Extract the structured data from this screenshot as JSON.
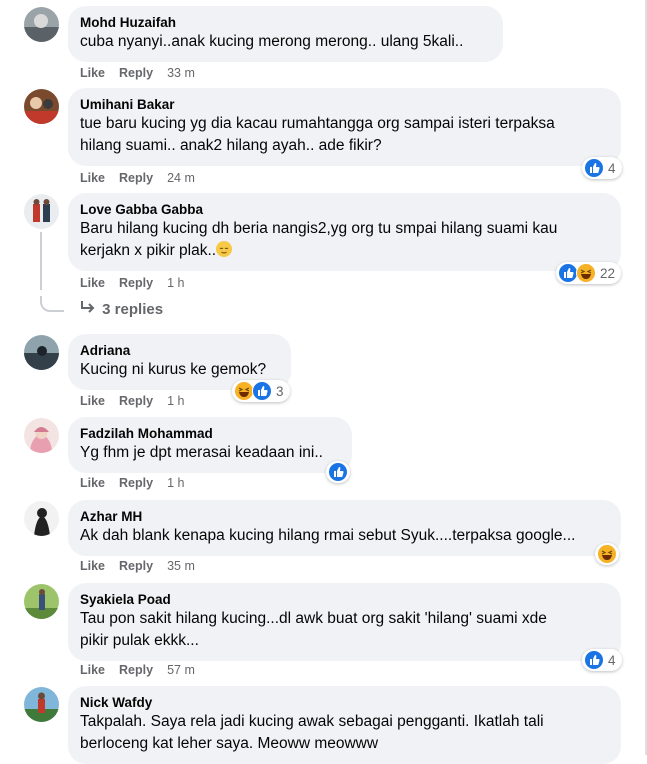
{
  "actions": {
    "like": "Like",
    "reply": "Reply"
  },
  "colors": {
    "bubble": "#f0f2f5",
    "like_blue": "#1b74e4",
    "haha_yellow": "#f7b125",
    "meta_gray": "#65676b"
  },
  "comments": [
    {
      "author": "Mohd Huzaifah",
      "text": "cuba nyanyi..anak kucing merong merong.. ulang 5kali..",
      "time": "33 m"
    },
    {
      "author": "Umihani Bakar",
      "text": "tue baru kucing yg dia kacau rumahtangga org sampai isteri terpaksa\nhilang suami.. anak2 hilang ayah.. ade fikir?",
      "time": "24 m",
      "reactions": {
        "icons": [
          "like-icon"
        ],
        "count": "4"
      }
    },
    {
      "author": "Love Gabba Gabba",
      "text": "Baru hilang kucing dh beria nangis2,yg org tu smpai hilang suami kau\nkerjakn x pikir plak..",
      "time": "1 h",
      "reactions": {
        "icons": [
          "like-icon",
          "haha-icon"
        ],
        "count": "22"
      }
    },
    {
      "author": "Adriana",
      "text": "Kucing ni kurus ke gemok?",
      "time": "1 h",
      "reactions": {
        "icons": [
          "haha-icon",
          "like-icon"
        ],
        "count": "3"
      }
    },
    {
      "author": "Fadzilah Mohammad",
      "text": "Yg fhm je dpt merasai keadaan ini..",
      "time": "1 h",
      "reactions": {
        "icons": [
          "like-icon"
        ],
        "count": ""
      }
    },
    {
      "author": "Azhar MH",
      "text": "Ak dah blank kenapa kucing hilang rmai sebut Syuk....terpaksa google...",
      "time": "35 m",
      "reactions": {
        "icons": [
          "haha-icon"
        ],
        "count": ""
      }
    },
    {
      "author": "Syakiela Poad",
      "text": "Tau pon sakit hilang kucing...dl awk buat org sakit 'hilang' suami xde\npikir pulak ekkk...",
      "time": "57 m",
      "reactions": {
        "icons": [
          "like-icon"
        ],
        "count": "4"
      }
    },
    {
      "author": "Nick Wafdy",
      "text": "Takpalah. Saya rela jadi kucing awak sebagai pengganti. Ikatlah tali\nberloceng kat leher saya. Meoww meowww"
    }
  ],
  "replies_link": {
    "label": "3 replies"
  }
}
